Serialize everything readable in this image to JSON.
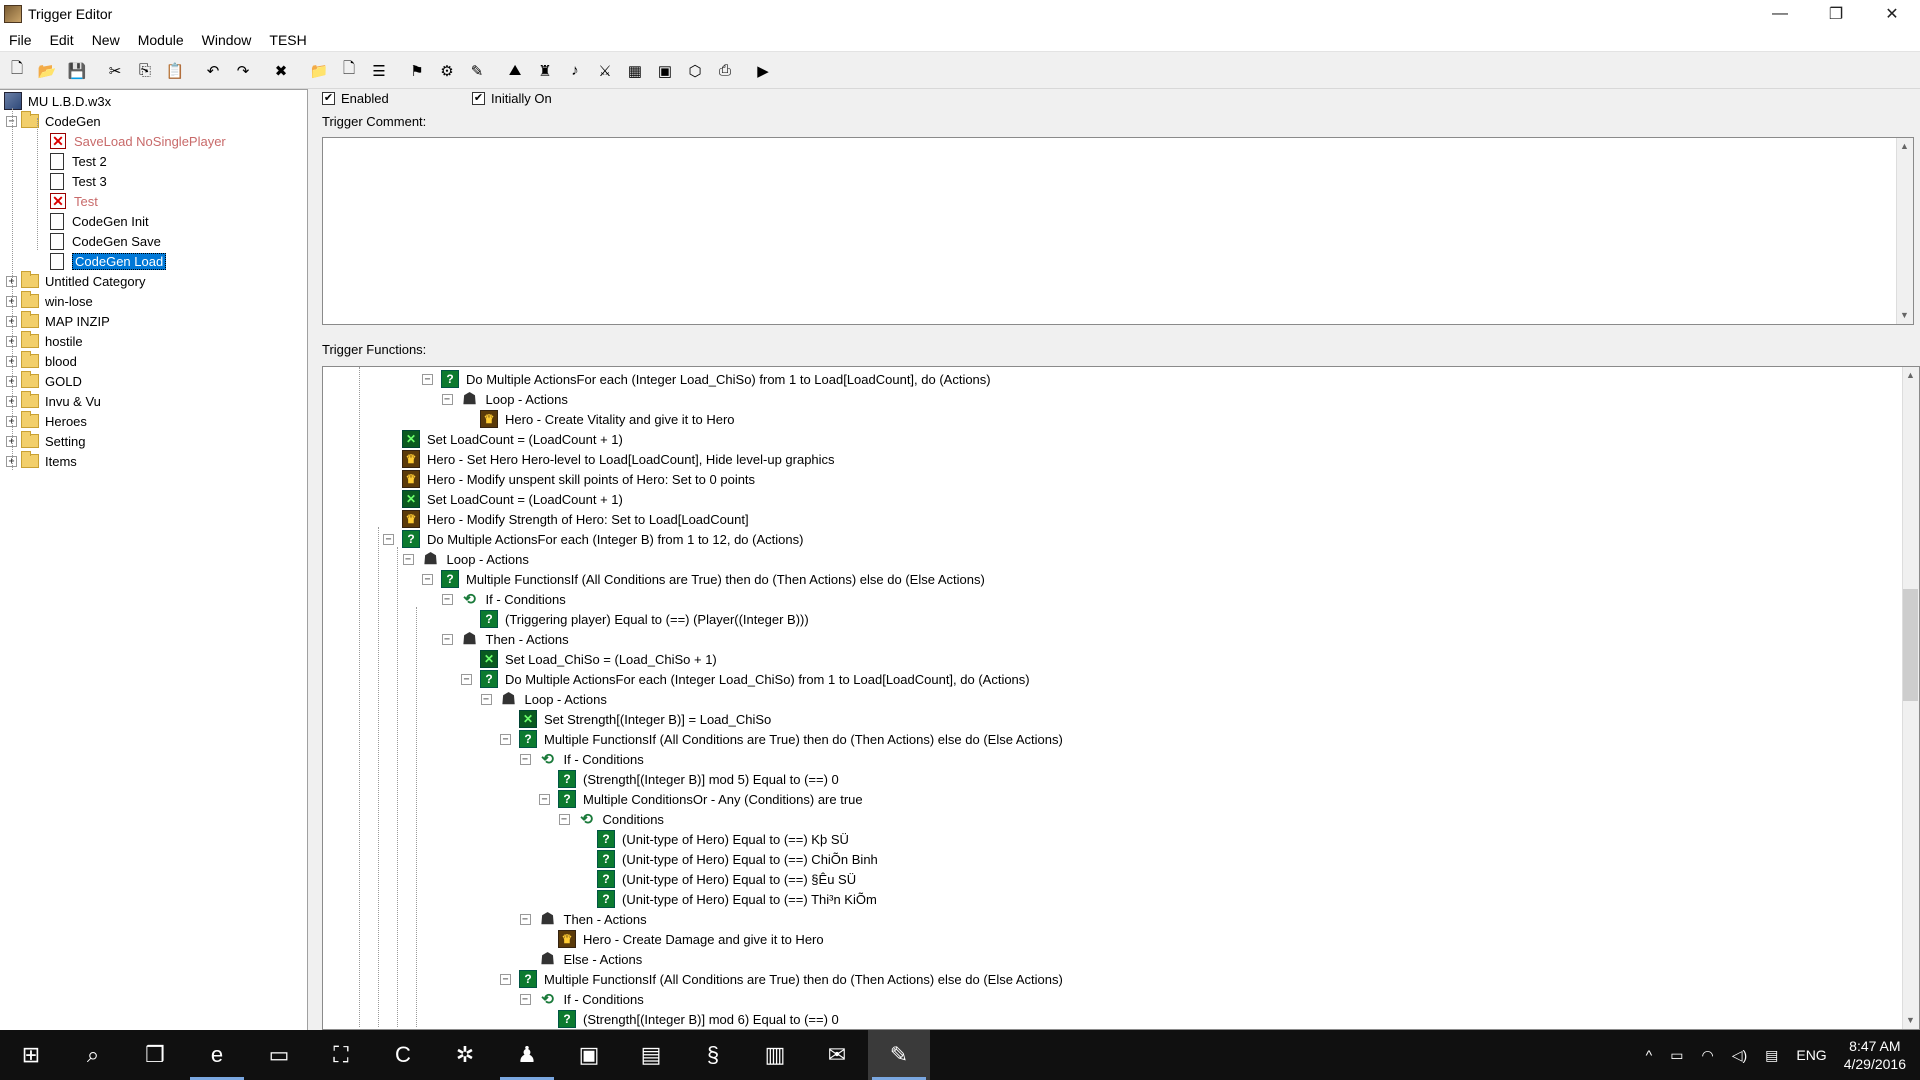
{
  "window": {
    "title": "Trigger Editor",
    "controls": {
      "minimize": "—",
      "restore": "❐",
      "close": "✕"
    }
  },
  "menu": [
    "File",
    "Edit",
    "New",
    "Module",
    "Window",
    "TESH"
  ],
  "toolbar": [
    "new-icon",
    "open-icon",
    "save-icon",
    "sep",
    "cut-icon",
    "copy-icon",
    "paste-icon",
    "sep",
    "undo-icon",
    "redo-icon",
    "sep",
    "delete-icon",
    "sep",
    "new-category-icon",
    "new-trigger-icon",
    "new-comment-icon",
    "sep",
    "flag-icon",
    "test-map-icon",
    "trigger-editor-icon",
    "sep",
    "terrain-editor-icon",
    "unit-editor-icon",
    "sound-editor-icon",
    "object-editor-icon",
    "campaign-editor-icon",
    "ai-editor-icon",
    "import-manager-icon",
    "tesh-icon",
    "sep",
    "save-test-icon"
  ],
  "tree": [
    {
      "label": "MU L.B.D.w3x",
      "icon": "map",
      "indent": 0
    },
    {
      "label": "CodeGen",
      "icon": "folder",
      "indent": 1,
      "expander": "−"
    },
    {
      "label": "SaveLoad NoSinglePlayer",
      "icon": "doc-x",
      "indent": 2,
      "disabled": true
    },
    {
      "label": "Test 2",
      "icon": "doc",
      "indent": 2
    },
    {
      "label": "Test 3",
      "icon": "doc",
      "indent": 2
    },
    {
      "label": "Test",
      "icon": "doc-x",
      "indent": 2,
      "disabled": true
    },
    {
      "label": "CodeGen Init",
      "icon": "doc",
      "indent": 2
    },
    {
      "label": "CodeGen Save",
      "icon": "doc",
      "indent": 2
    },
    {
      "label": "CodeGen Load",
      "icon": "doc",
      "indent": 2,
      "selected": true
    },
    {
      "label": "Untitled Category",
      "icon": "folder",
      "indent": 1,
      "expander": "+"
    },
    {
      "label": "win-lose",
      "icon": "folder",
      "indent": 1,
      "expander": "+"
    },
    {
      "label": "MAP INZIP",
      "icon": "folder",
      "indent": 1,
      "expander": "+"
    },
    {
      "label": "hostile",
      "icon": "folder",
      "indent": 1,
      "expander": "+"
    },
    {
      "label": "blood",
      "icon": "folder",
      "indent": 1,
      "expander": "+"
    },
    {
      "label": "GOLD",
      "icon": "folder",
      "indent": 1,
      "expander": "+"
    },
    {
      "label": "Invu & Vu",
      "icon": "folder",
      "indent": 1,
      "expander": "+"
    },
    {
      "label": "Heroes",
      "icon": "folder",
      "indent": 1,
      "expander": "+"
    },
    {
      "label": "Setting",
      "icon": "folder",
      "indent": 1,
      "expander": "+"
    },
    {
      "label": "Items",
      "icon": "folder",
      "indent": 1,
      "expander": "+"
    }
  ],
  "trigger": {
    "enabled_label": "Enabled",
    "enabled": true,
    "initially_on_label": "Initially On",
    "initially_on": true,
    "comment_label": "Trigger Comment:",
    "comment": "",
    "functions_label": "Trigger Functions:"
  },
  "functions": [
    {
      "text": "Do Multiple ActionsFor each (Integer Load_ChiSo) from 1 to Load[LoadCount], do (Actions)",
      "icon": "q",
      "level": 2,
      "expander": "−"
    },
    {
      "text": "Loop - Actions",
      "icon": "loop",
      "level": 3,
      "expander": "−"
    },
    {
      "text": "Hero - Create Vitality  and give it to Hero",
      "icon": "hero",
      "level": 4
    },
    {
      "text": "Set LoadCount = (LoadCount + 1)",
      "icon": "set",
      "level": 0
    },
    {
      "text": "Hero - Set Hero Hero-level to Load[LoadCount], Hide level-up graphics",
      "icon": "hero",
      "level": 0
    },
    {
      "text": "Hero - Modify unspent skill points of Hero: Set to 0 points",
      "icon": "hero",
      "level": 0
    },
    {
      "text": "Set LoadCount = (LoadCount + 1)",
      "icon": "set",
      "level": 0
    },
    {
      "text": "Hero - Modify Strength of Hero: Set to Load[LoadCount]",
      "icon": "hero",
      "level": 0
    },
    {
      "text": "Do Multiple ActionsFor each (Integer B) from 1 to 12, do (Actions)",
      "icon": "q",
      "level": 0,
      "expander": "−"
    },
    {
      "text": "Loop - Actions",
      "icon": "loop",
      "level": 1,
      "expander": "−"
    },
    {
      "text": "Multiple FunctionsIf (All Conditions are True) then do (Then Actions) else do (Else Actions)",
      "icon": "q",
      "level": 2,
      "expander": "−"
    },
    {
      "text": "If - Conditions",
      "icon": "cond",
      "level": 3,
      "expander": "−"
    },
    {
      "text": "(Triggering player) Equal to (==) (Player((Integer B)))",
      "icon": "q",
      "level": 4
    },
    {
      "text": "Then - Actions",
      "icon": "loop",
      "level": 3,
      "expander": "−"
    },
    {
      "text": "Set Load_ChiSo = (Load_ChiSo + 1)",
      "icon": "set",
      "level": 4
    },
    {
      "text": "Do Multiple ActionsFor each (Integer Load_ChiSo) from 1 to Load[LoadCount], do (Actions)",
      "icon": "q",
      "level": 4,
      "expander": "−"
    },
    {
      "text": "Loop - Actions",
      "icon": "loop",
      "level": 5,
      "expander": "−"
    },
    {
      "text": "Set Strength[(Integer B)] = Load_ChiSo",
      "icon": "set",
      "level": 6
    },
    {
      "text": "Multiple FunctionsIf (All Conditions are True) then do (Then Actions) else do (Else Actions)",
      "icon": "q",
      "level": 6,
      "expander": "−"
    },
    {
      "text": "If - Conditions",
      "icon": "cond",
      "level": 7,
      "expander": "−"
    },
    {
      "text": "(Strength[(Integer B)] mod 5) Equal to (==) 0",
      "icon": "q",
      "level": 8
    },
    {
      "text": "Multiple ConditionsOr - Any (Conditions) are true",
      "icon": "q",
      "level": 8,
      "expander": "−"
    },
    {
      "text": "Conditions",
      "icon": "cond",
      "level": 9,
      "expander": "−"
    },
    {
      "text": "(Unit-type of Hero) Equal to (==) Kþ SÜ",
      "icon": "q",
      "level": 10
    },
    {
      "text": "(Unit-type of Hero) Equal to (==) ChiÕn Binh",
      "icon": "q",
      "level": 10
    },
    {
      "text": "(Unit-type of Hero) Equal to (==) §Êu SÜ",
      "icon": "q",
      "level": 10
    },
    {
      "text": "(Unit-type of Hero) Equal to (==) Thi³n KiÕm",
      "icon": "q",
      "level": 10
    },
    {
      "text": "Then - Actions",
      "icon": "loop",
      "level": 7,
      "expander": "−"
    },
    {
      "text": "Hero - Create Damage and give it to Hero",
      "icon": "hero",
      "level": 8
    },
    {
      "text": "Else - Actions",
      "icon": "loop",
      "level": 7
    },
    {
      "text": "Multiple FunctionsIf (All Conditions are True) then do (Then Actions) else do (Else Actions)",
      "icon": "q",
      "level": 6,
      "expander": "−"
    },
    {
      "text": "If - Conditions",
      "icon": "cond",
      "level": 7,
      "expander": "−"
    },
    {
      "text": "(Strength[(Integer B)] mod 6) Equal to (==) 0",
      "icon": "q",
      "level": 8
    }
  ],
  "taskbar": {
    "apps": [
      {
        "name": "start-icon",
        "glyph": "⊞"
      },
      {
        "name": "search-icon",
        "glyph": "⌕"
      },
      {
        "name": "task-view-icon",
        "glyph": "❒"
      },
      {
        "name": "edge-icon",
        "glyph": "e",
        "active": true
      },
      {
        "name": "file-explorer-icon",
        "glyph": "▭"
      },
      {
        "name": "store-icon",
        "glyph": "⛶"
      },
      {
        "name": "app-c-icon",
        "glyph": "C"
      },
      {
        "name": "app-red-icon",
        "glyph": "✲"
      },
      {
        "name": "app-figure-icon",
        "glyph": "♟",
        "active": true
      },
      {
        "name": "app-green-icon",
        "glyph": "▣"
      },
      {
        "name": "app-cards-icon",
        "glyph": "▤"
      },
      {
        "name": "app-swirl-icon",
        "glyph": "§"
      },
      {
        "name": "app-scroll-icon",
        "glyph": "▥"
      },
      {
        "name": "app-mail-icon",
        "glyph": "✉"
      },
      {
        "name": "app-world-editor-icon",
        "glyph": "✎",
        "active": true,
        "current": true
      }
    ],
    "tray": {
      "chevron": "^",
      "battery": "▭",
      "network": "◠",
      "volume": "◁)",
      "notifications": "▤",
      "language": "ENG"
    },
    "time": "8:47 AM",
    "date": "4/29/2016"
  }
}
